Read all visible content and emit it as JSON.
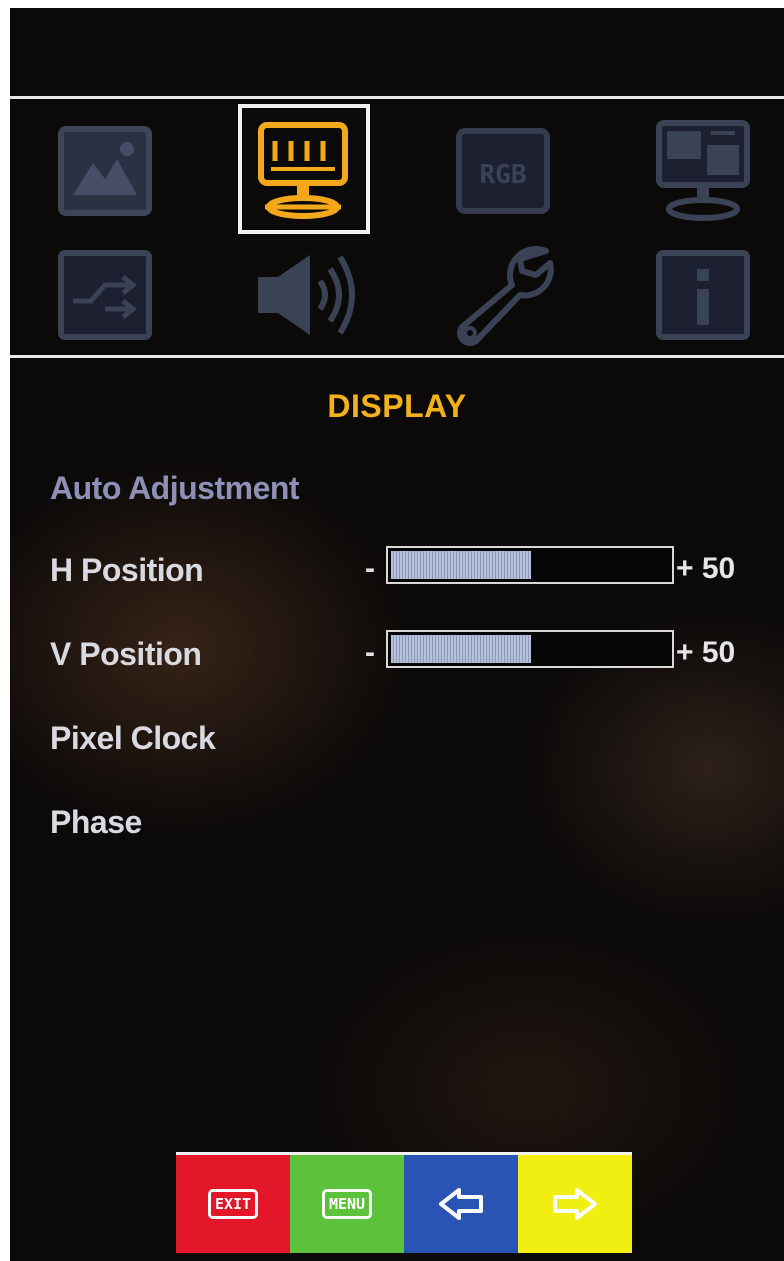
{
  "menu": {
    "title": "DISPLAY",
    "icons": [
      {
        "name": "picture-icon",
        "selected": false
      },
      {
        "name": "display-icon",
        "selected": true
      },
      {
        "name": "rgb-icon",
        "label": "RGB",
        "selected": false
      },
      {
        "name": "pip-icon",
        "selected": false
      },
      {
        "name": "input-source-icon",
        "selected": false
      },
      {
        "name": "audio-icon",
        "selected": false
      },
      {
        "name": "setup-wrench-icon",
        "selected": false
      },
      {
        "name": "info-icon",
        "label": "i",
        "selected": false
      }
    ],
    "items": [
      {
        "label": "Auto Adjustment"
      },
      {
        "label": "H Position",
        "minus": "-",
        "value": "+ 50",
        "level": 0.5
      },
      {
        "label": "V Position",
        "minus": "-",
        "value": "+ 50",
        "level": 0.5
      },
      {
        "label": "Pixel Clock"
      },
      {
        "label": "Phase"
      }
    ]
  },
  "buttons": [
    {
      "label": "EXIT",
      "color": "#e3162a"
    },
    {
      "label": "MENU",
      "color": "#5cc23a"
    },
    {
      "name": "left-arrow",
      "color": "#2a53b6"
    },
    {
      "name": "right-arrow",
      "color": "#f1ef12"
    }
  ],
  "colors": {
    "accent": "#f4b21a",
    "inactive_icon": "#3a4256",
    "active_item": "#8e90b8"
  }
}
